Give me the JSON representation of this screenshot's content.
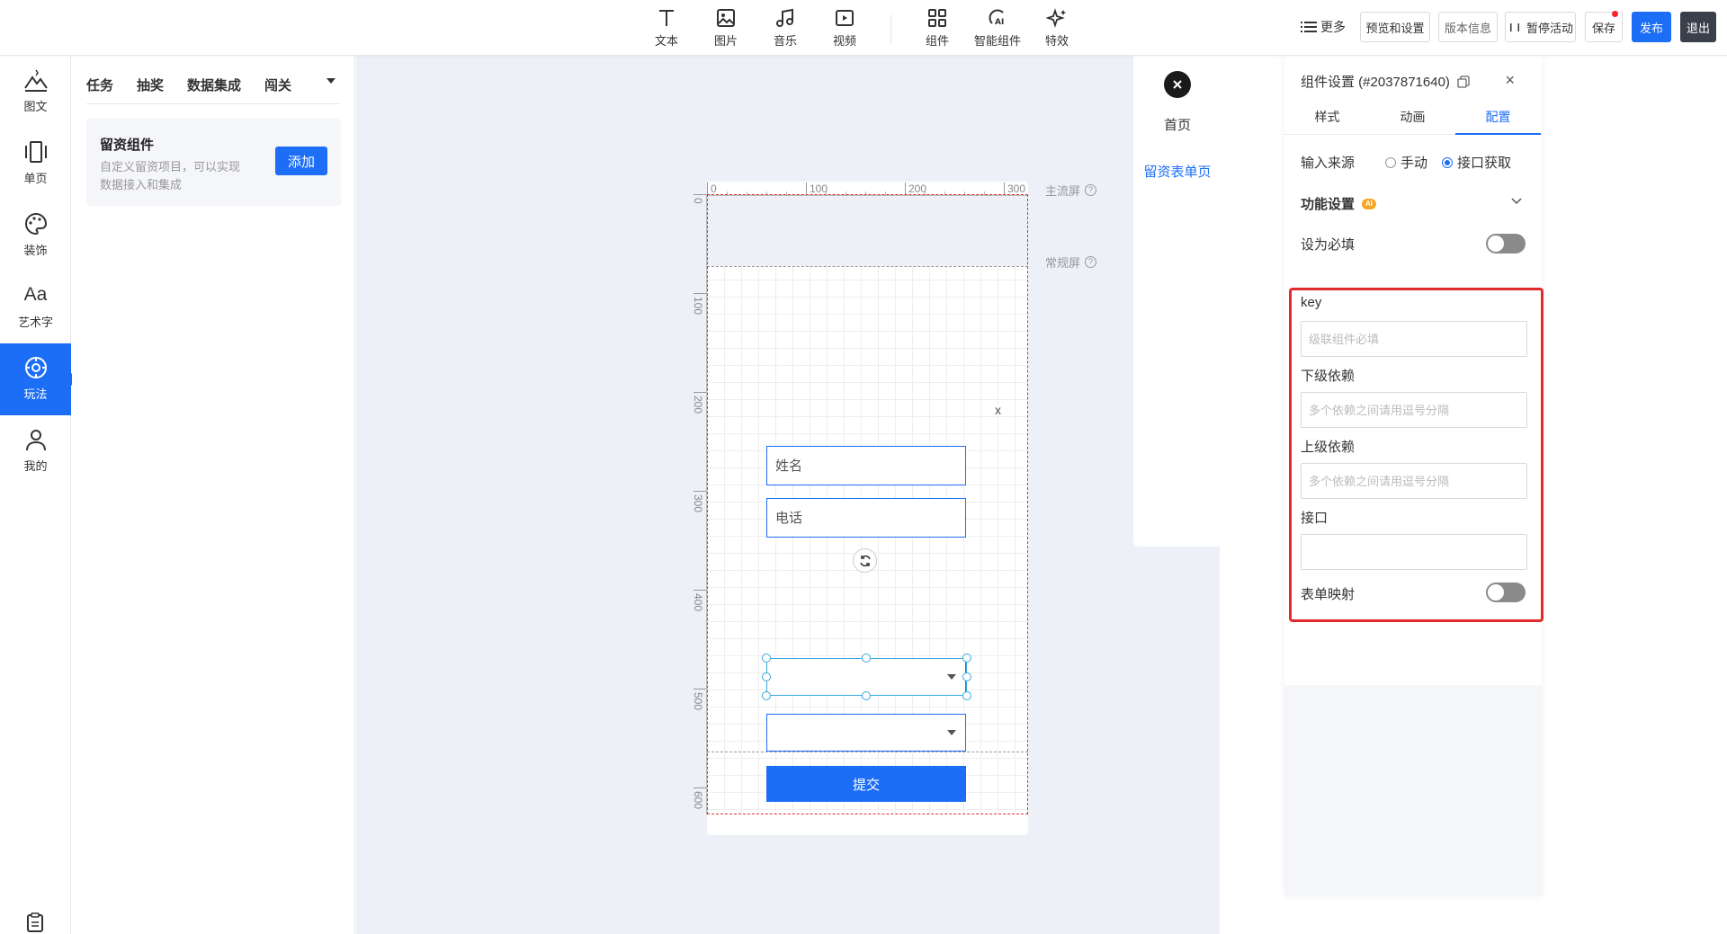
{
  "topbar": {
    "tools": [
      {
        "label": "文本",
        "icon": "text-icon"
      },
      {
        "label": "图片",
        "icon": "image-icon"
      },
      {
        "label": "音乐",
        "icon": "music-icon"
      },
      {
        "label": "视频",
        "icon": "video-icon"
      },
      {
        "label": "组件",
        "icon": "components-icon"
      },
      {
        "label": "智能组件",
        "icon": "ai-components-icon"
      },
      {
        "label": "特效",
        "icon": "sparkle-icon"
      }
    ],
    "more_label": "更多",
    "preview_label": "预览和设置",
    "version_label": "版本信息",
    "pause_label": "暂停活动",
    "save_label": "保存",
    "publish_label": "发布",
    "exit_label": "退出"
  },
  "leftbar": {
    "items": [
      {
        "label": "图文",
        "icon": "mountain-icon"
      },
      {
        "label": "单页",
        "icon": "page-icon"
      },
      {
        "label": "装饰",
        "icon": "palette-icon"
      },
      {
        "label": "艺术字",
        "icon": "art-text-icon"
      },
      {
        "label": "玩法",
        "icon": "gameplay-icon",
        "active": true
      },
      {
        "label": "我的",
        "icon": "user-icon"
      }
    ],
    "art_text_glyph": "Aa"
  },
  "panel2": {
    "tabs": [
      "任务",
      "抽奖",
      "数据集成",
      "闯关"
    ],
    "card": {
      "title": "留资组件",
      "desc": "自定义留资项目，可以实现数据接入和集成",
      "add_label": "添加"
    }
  },
  "canvas": {
    "ruler_top": [
      "0",
      "100",
      "200",
      "300"
    ],
    "ruler_left": [
      "0",
      "100",
      "200",
      "300",
      "400",
      "500",
      "600"
    ],
    "main_screen_label": "主流屏",
    "regular_screen_label": "常规屏",
    "close_label": "x",
    "name_placeholder": "姓名",
    "phone_placeholder": "电话",
    "submit_label": "提交",
    "help_glyph": "?"
  },
  "pagelist": {
    "home_label": "首页",
    "form_label": "留资表单页"
  },
  "settings": {
    "title": "组件设置 (#2037871640)",
    "tabs": [
      "样式",
      "动画",
      "配置"
    ],
    "active_tab": "配置",
    "input_source_label": "输入来源",
    "radio_manual": "手动",
    "radio_api": "接口获取",
    "func_title": "功能设置",
    "ai_badge": "AI",
    "required_label": "设为必填",
    "key_label": "key",
    "key_placeholder": "级联组件必填",
    "child_dep_label": "下级依赖",
    "child_dep_placeholder": "多个依赖之间请用逗号分隔",
    "parent_dep_label": "上级依赖",
    "parent_dep_placeholder": "多个依赖之间请用逗号分隔",
    "api_label": "接口",
    "api_value": "",
    "form_mapping_label": "表单映射"
  },
  "colors": {
    "primary": "#1c6ef7",
    "highlight_box": "#e12a2a",
    "exit_bg": "#3a3f4b"
  }
}
